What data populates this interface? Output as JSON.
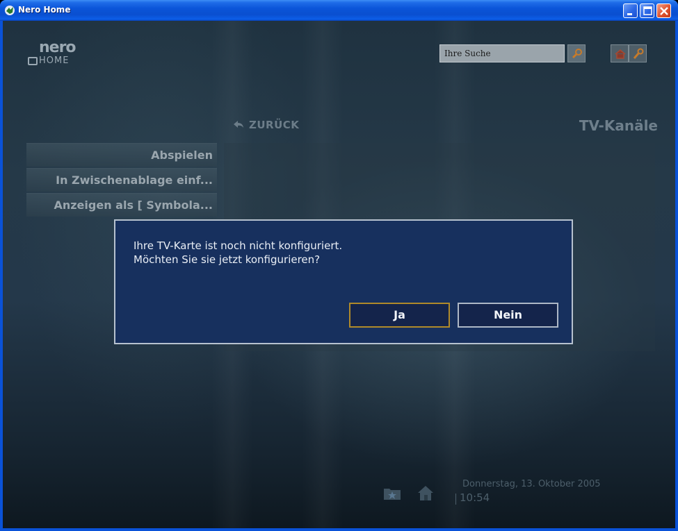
{
  "window": {
    "title": "Nero Home",
    "controls": [
      "minimize-icon",
      "maximize-icon",
      "close-icon"
    ]
  },
  "logo": {
    "line1": "nero",
    "line2": "HOME"
  },
  "search": {
    "value": "Ihre Suche",
    "icon": "search-icon"
  },
  "toolbar": {
    "icons": [
      "home-icon",
      "settings-wrench-icon"
    ]
  },
  "nav": {
    "back_label": "ZURÜCK",
    "back_icon": "back-arrow-icon"
  },
  "page": {
    "title": "TV-Kanäle"
  },
  "menu": {
    "items": [
      {
        "label": "Abspielen"
      },
      {
        "label": "In Zwischenablage einf..."
      },
      {
        "label": "Anzeigen als [ Symbola..."
      }
    ]
  },
  "dialog": {
    "line1": "Ihre TV-Karte ist noch nicht konfiguriert.",
    "line2": "Möchten Sie sie jetzt konfigurieren?",
    "yes_label": "Ja",
    "no_label": "Nein"
  },
  "footer": {
    "icons": [
      "folder-star-icon",
      "home-icon"
    ],
    "date": "Donnerstag, 13. Oktober 2005",
    "time": "10:54"
  },
  "colors": {
    "titlebar": "#0b55d9",
    "dialog_bg": "#17305e",
    "focus_border": "#b08a2a"
  }
}
